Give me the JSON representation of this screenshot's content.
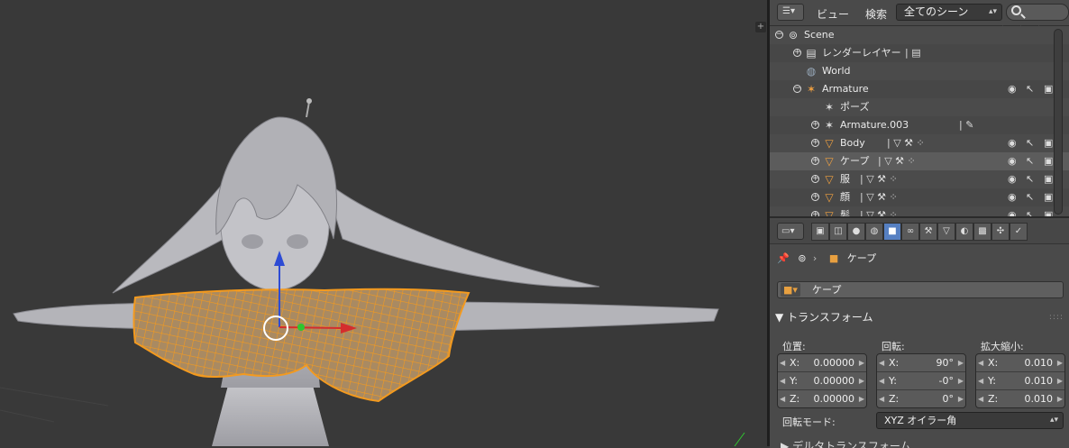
{
  "outliner": {
    "menu": [
      "ビュー",
      "検索"
    ],
    "scene_select": "全てのシーン",
    "rows": [
      {
        "name": "Scene",
        "icon": "scene-icon",
        "indent": 0,
        "expander": "minus"
      },
      {
        "name": "レンダーレイヤー",
        "icon": "render-layers-icon",
        "indent": 1,
        "expander": "plus",
        "extra": "render-layer-icon"
      },
      {
        "name": "World",
        "icon": "world-icon",
        "indent": 1,
        "expander": "none"
      },
      {
        "name": "Armature",
        "icon": "armature-icon",
        "indent": 1,
        "expander": "minus",
        "visibility": true
      },
      {
        "name": "ポーズ",
        "icon": "pose-icon",
        "indent": 2,
        "expander": "none"
      },
      {
        "name": "Armature.003",
        "icon": "armature-data-icon",
        "indent": 2,
        "expander": "plus",
        "extra": "bone-icon"
      },
      {
        "name": "Body",
        "icon": "mesh-object-icon",
        "indent": 2,
        "expander": "plus",
        "extra": "mesh-modifier-vgroup-icons",
        "visibility": true
      },
      {
        "name": "ケープ",
        "icon": "mesh-object-icon",
        "indent": 2,
        "expander": "plus",
        "extra": "mesh-modifier-vgroup-icons",
        "visibility": true,
        "active": true
      },
      {
        "name": "服",
        "icon": "mesh-object-icon",
        "indent": 2,
        "expander": "plus",
        "extra": "mesh-modifier-vgroup-icons",
        "visibility": true
      },
      {
        "name": "顔",
        "icon": "mesh-object-icon",
        "indent": 2,
        "expander": "plus",
        "extra": "mesh-modifier-vgroup-icons",
        "visibility": true
      },
      {
        "name": "髪",
        "icon": "mesh-object-icon",
        "indent": 2,
        "expander": "plus",
        "extra": "mesh-modifier-vgroup-icons",
        "visibility": true
      }
    ]
  },
  "properties": {
    "breadcrumb_object": "ケープ",
    "object_name": "ケープ",
    "transform_panel": "トランスフォーム",
    "location_label": "位置:",
    "rotation_label": "回転:",
    "scale_label": "拡大縮小:",
    "location": [
      {
        "axis": "X:",
        "value": "0.00000"
      },
      {
        "axis": "Y:",
        "value": "0.00000"
      },
      {
        "axis": "Z:",
        "value": "0.00000"
      }
    ],
    "rotation": [
      {
        "axis": "X:",
        "value": "90°"
      },
      {
        "axis": "Y:",
        "value": "-0°"
      },
      {
        "axis": "Z:",
        "value": "0°"
      }
    ],
    "scale": [
      {
        "axis": "X:",
        "value": "0.010"
      },
      {
        "axis": "Y:",
        "value": "0.010"
      },
      {
        "axis": "Z:",
        "value": "0.010"
      }
    ],
    "rotation_mode_label": "回転モード:",
    "rotation_mode_value": "XYZ オイラー角",
    "delta_panel": "デルタトランスフォーム"
  },
  "colors": {
    "viewport_bg": "#393939",
    "selection_orange": "#f39a1f",
    "active_tab_blue": "#5680c2"
  }
}
